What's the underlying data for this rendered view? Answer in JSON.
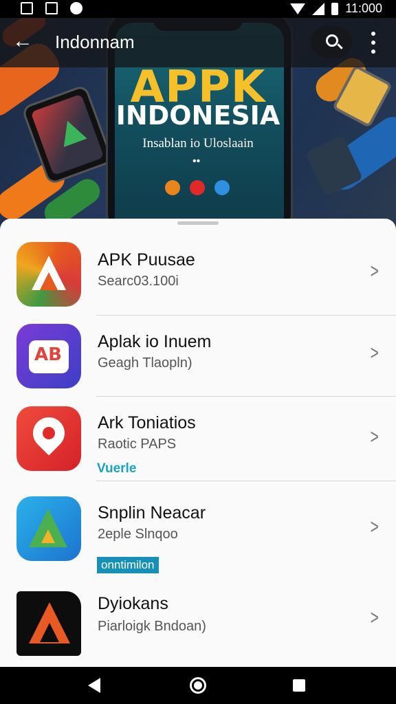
{
  "status_bar": {
    "time": "11:000"
  },
  "app_bar": {
    "title": "Indonnam"
  },
  "hero": {
    "title": "APPK",
    "subtitle": "INDONESIA",
    "tagline": "Insablan io Uloslaain",
    "dots": "••"
  },
  "apps": [
    {
      "name": "APK Puusae",
      "subtitle": "Searc03.100i",
      "icon": "apk-triangle-icon"
    },
    {
      "name": "Aplak io Inuem",
      "subtitle": "Geagh Tlaopln)",
      "icon": "app-card-icon"
    },
    {
      "name": "Ark Toniatios",
      "subtitle": "Raotic PAPS",
      "tag": "Vuerle",
      "icon": "map-pin-icon"
    },
    {
      "name": "Snplin Neacar",
      "subtitle": "2eple Slnqoo",
      "badge": "onntimilon",
      "icon": "triangle-logo-icon"
    },
    {
      "name": "Dyiokans",
      "subtitle": "Piarloigk Bndoan)",
      "icon": "dark-triangle-icon"
    }
  ],
  "colors": {
    "accent_teal": "#1aa3c1",
    "hero_yellow": "#f5c02a",
    "badge": "#1591b8"
  }
}
